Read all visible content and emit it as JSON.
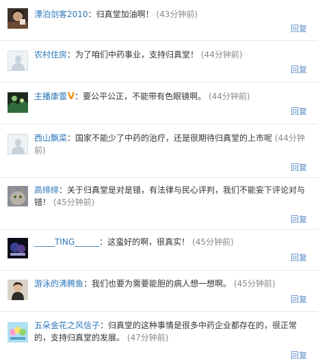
{
  "reply_label": "回复",
  "comments": [
    {
      "user": "漂泊剑客2010",
      "text": "归真堂加油啊！",
      "time": "(43分钟前)"
    },
    {
      "user": "农村住房",
      "text": "为了咱们中药事业，支持归真堂！",
      "time": "(44分钟前)"
    },
    {
      "user": "主播康蕾",
      "text": "要公平公正，不能带有色眼镜啊。",
      "time": "(44分钟前)",
      "badge": "V"
    },
    {
      "user": "西山飘菜",
      "text": "国家不能少了中药的治疗，还是很期待归真堂的上市呢",
      "time": "(44分钟前)"
    },
    {
      "user": "高绯绯",
      "text": "关于归真堂是对是错，有法律与民心评判，我们不能妄下评论对与错！",
      "time": "(45分钟前)"
    },
    {
      "user": "_____TING______",
      "text": "这蛮好的啊，很真实！",
      "time": "(45分钟前)"
    },
    {
      "user": "游泳的沸腾鱼",
      "text": "我们也要为需要能胆的病人想一想啊。",
      "time": "(45分钟前)"
    },
    {
      "user": "五朵金花之风信子",
      "text": "归真堂的这种事情是很多中药企业都存在的，很正常的，支持归真堂的发展。",
      "time": "(47分钟前)"
    }
  ]
}
